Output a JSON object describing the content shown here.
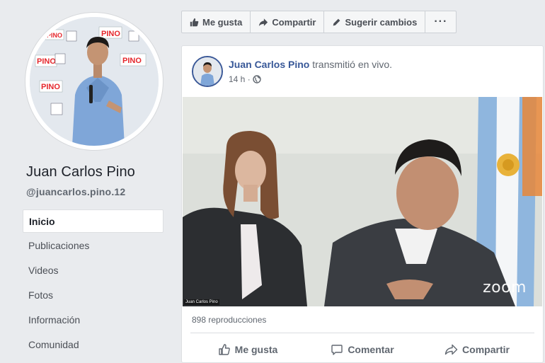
{
  "profile": {
    "name": "Juan Carlos Pino",
    "handle": "@juancarlos.pino.12",
    "banner_words": [
      "PINO",
      "PINO",
      "PINO",
      "PINO",
      "PINO"
    ]
  },
  "sidebar": {
    "items": [
      {
        "label": "Inicio",
        "active": true
      },
      {
        "label": "Publicaciones",
        "active": false
      },
      {
        "label": "Videos",
        "active": false
      },
      {
        "label": "Fotos",
        "active": false
      },
      {
        "label": "Información",
        "active": false
      },
      {
        "label": "Comunidad",
        "active": false
      }
    ]
  },
  "toolbar": {
    "like_label": "Me gusta",
    "share_label": "Compartir",
    "suggest_label": "Sugerir cambios",
    "more_label": "···"
  },
  "post": {
    "author": "Juan Carlos Pino",
    "action_text": " transmitió en vivo.",
    "time": "14 h ·",
    "video_caption": "Juan Carlos Pino",
    "video_watermark": "zoom",
    "views": "898 reproducciones",
    "like_label": "Me gusta",
    "comment_label": "Comentar",
    "share_label": "Compartir"
  },
  "colors": {
    "link_blue": "#385898",
    "page_bg": "#e9ebee",
    "card_bg": "#ffffff",
    "muted_text": "#606770"
  }
}
